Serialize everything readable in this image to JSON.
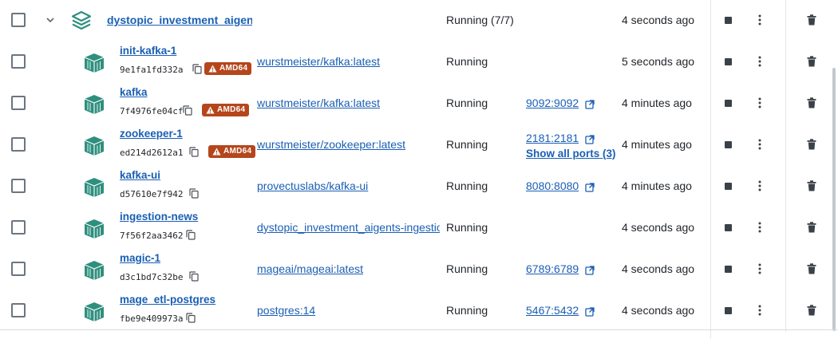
{
  "group": {
    "name": "dystopic_investment_aigents",
    "status": "Running (7/7)",
    "time": "4 seconds ago"
  },
  "containers": [
    {
      "name": "init-kafka-1",
      "id": "9e1fa1fd332a",
      "arch": "AMD64",
      "image": "wurstmeister/kafka:latest",
      "status": "Running",
      "ports": [],
      "show_ports": "",
      "time": "5 seconds ago"
    },
    {
      "name": "kafka",
      "id": "7f4976fe04cf",
      "arch": "AMD64",
      "image": "wurstmeister/kafka:latest",
      "status": "Running",
      "ports": [
        "9092:9092"
      ],
      "show_ports": "",
      "time": "4 minutes ago"
    },
    {
      "name": "zookeeper-1",
      "id": "ed214d2612a1",
      "arch": "AMD64",
      "image": "wurstmeister/zookeeper:latest",
      "status": "Running",
      "ports": [
        "2181:2181"
      ],
      "show_ports": "Show all ports (3)",
      "time": "4 minutes ago"
    },
    {
      "name": "kafka-ui",
      "id": "d57610e7f942",
      "arch": "",
      "image": "provectuslabs/kafka-ui",
      "status": "Running",
      "ports": [
        "8080:8080"
      ],
      "show_ports": "",
      "time": "4 minutes ago"
    },
    {
      "name": "ingestion-news",
      "id": "7f56f2aa3462",
      "arch": "",
      "image": "dystopic_investment_aigents-ingestion-news",
      "status": "Running",
      "ports": [],
      "show_ports": "",
      "time": "4 seconds ago"
    },
    {
      "name": "magic-1",
      "id": "d3c1bd7c32be",
      "arch": "",
      "image": "mageai/mageai:latest",
      "status": "Running",
      "ports": [
        "6789:6789"
      ],
      "show_ports": "",
      "time": "4 seconds ago"
    },
    {
      "name": "mage_etl-postgres",
      "id": "fbe9e409973a",
      "arch": "",
      "image": "postgres:14",
      "status": "Running",
      "ports": [
        "5467:5432"
      ],
      "show_ports": "",
      "time": "4 seconds ago"
    }
  ],
  "colors": {
    "link": "#1a5fb4",
    "badge": "#b5461c",
    "container_icon": "#2f8f7e"
  },
  "icons": [
    "checkbox",
    "chevron-down-icon",
    "stack-icon",
    "container-icon",
    "copy-icon",
    "warning-icon",
    "external-link-icon",
    "stop-icon",
    "kebab-icon",
    "trash-icon"
  ]
}
